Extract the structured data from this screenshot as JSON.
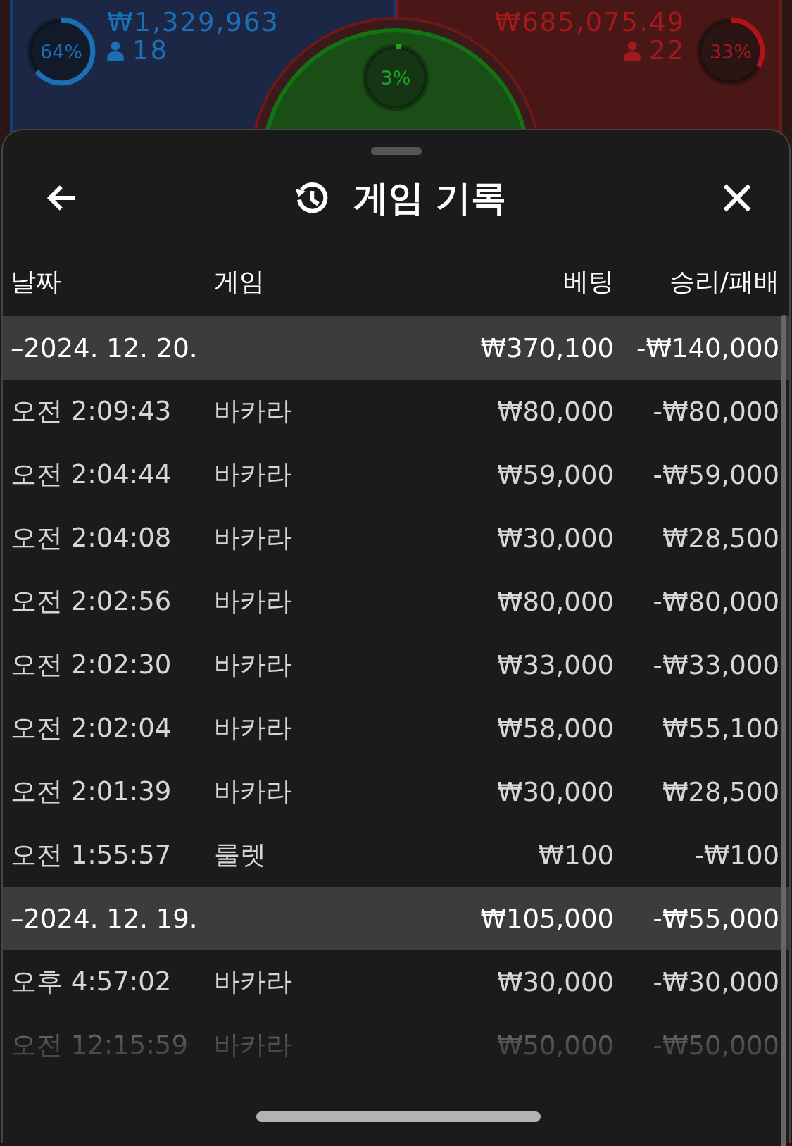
{
  "game_strip": {
    "player": {
      "percent": "64%",
      "amount": "₩1,329,963",
      "count": "18"
    },
    "tie": {
      "percent": "3%"
    },
    "banker": {
      "percent": "33%",
      "amount": "₩685,075.49",
      "count": "22"
    }
  },
  "sheet": {
    "title": "게임 기록"
  },
  "table": {
    "columns": [
      "날짜",
      "게임",
      "베팅",
      "승리/패배"
    ],
    "groups": [
      {
        "date": "–2024. 12. 20.",
        "bet": "₩370,100",
        "result": "-₩140,000",
        "rows": [
          {
            "time": "오전 2:09:43",
            "game": "바카라",
            "bet": "₩80,000",
            "result": "-₩80,000"
          },
          {
            "time": "오전 2:04:44",
            "game": "바카라",
            "bet": "₩59,000",
            "result": "-₩59,000"
          },
          {
            "time": "오전 2:04:08",
            "game": "바카라",
            "bet": "₩30,000",
            "result": "₩28,500"
          },
          {
            "time": "오전 2:02:56",
            "game": "바카라",
            "bet": "₩80,000",
            "result": "-₩80,000"
          },
          {
            "time": "오전 2:02:30",
            "game": "바카라",
            "bet": "₩33,000",
            "result": "-₩33,000"
          },
          {
            "time": "오전 2:02:04",
            "game": "바카라",
            "bet": "₩58,000",
            "result": "₩55,100"
          },
          {
            "time": "오전 2:01:39",
            "game": "바카라",
            "bet": "₩30,000",
            "result": "₩28,500"
          },
          {
            "time": "오전 1:55:57",
            "game": "룰렛",
            "bet": "₩100",
            "result": "-₩100"
          }
        ]
      },
      {
        "date": "–2024. 12. 19.",
        "bet": "₩105,000",
        "result": "-₩55,000",
        "rows": [
          {
            "time": "오후 4:57:02",
            "game": "바카라",
            "bet": "₩30,000",
            "result": "-₩30,000"
          },
          {
            "time": "오전 12:15:59",
            "game": "바카라",
            "bet": "₩50,000",
            "result": "-₩50,000"
          }
        ]
      }
    ]
  }
}
